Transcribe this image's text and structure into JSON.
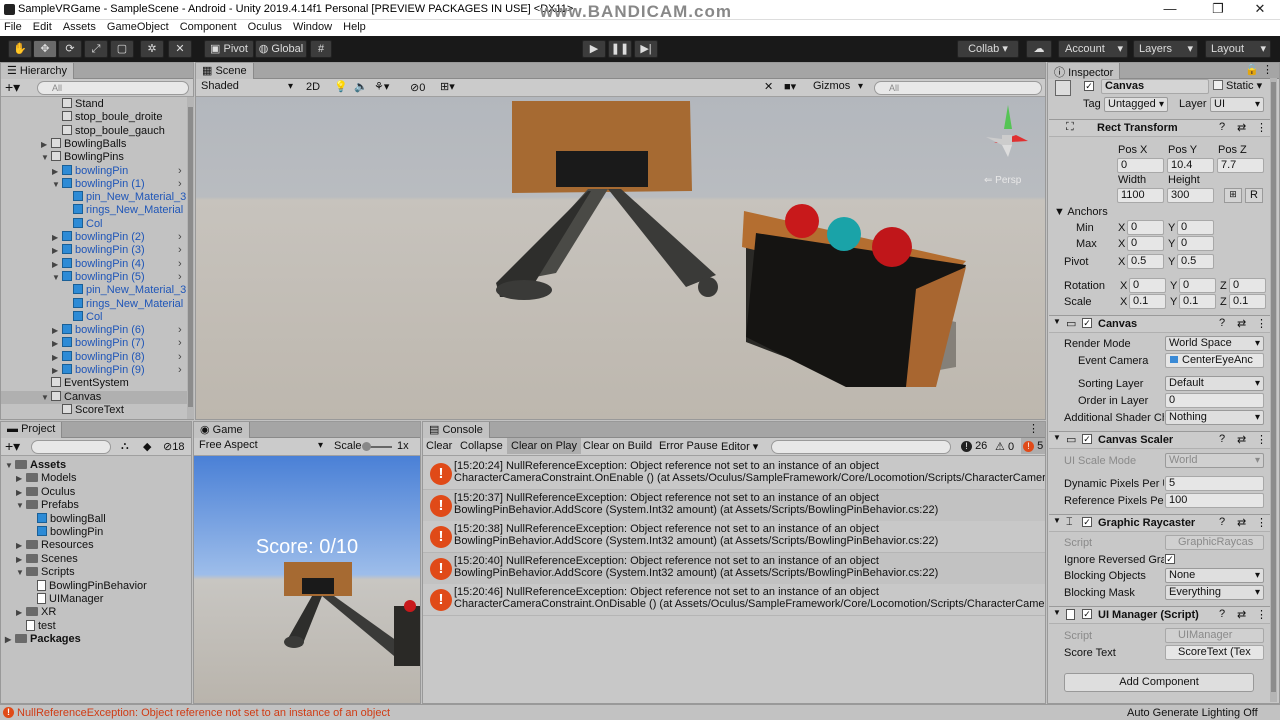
{
  "window": {
    "title": "SampleVRGame - SampleScene - Android - Unity 2019.4.14f1 Personal [PREVIEW PACKAGES IN USE] <DX11>",
    "watermark": "www.BANDICAM.com",
    "minimize": "—",
    "maximize": "❐",
    "close": "✕"
  },
  "menu": [
    "File",
    "Edit",
    "Assets",
    "GameObject",
    "Component",
    "Oculus",
    "Window",
    "Help"
  ],
  "toolbar": {
    "pivot": "Pivot",
    "global": "Global",
    "collab": "Collab ▾",
    "account": "Account",
    "layers": "Layers",
    "layout": "Layout"
  },
  "hierarchy": {
    "tab": "Hierarchy",
    "search_placeholder": "All",
    "items": [
      {
        "label": "Stand",
        "indent": 3,
        "prefab": false,
        "arrow": ""
      },
      {
        "label": "stop_boule_droite",
        "indent": 3,
        "prefab": false,
        "arrow": ""
      },
      {
        "label": "stop_boule_gauch",
        "indent": 3,
        "prefab": false,
        "arrow": ""
      },
      {
        "label": "BowlingBalls",
        "indent": 2,
        "prefab": false,
        "arrow": "▶"
      },
      {
        "label": "BowlingPins",
        "indent": 2,
        "prefab": false,
        "arrow": "▼"
      },
      {
        "label": "bowlingPin",
        "indent": 3,
        "prefab": true,
        "arrow": "▶"
      },
      {
        "label": "bowlingPin (1)",
        "indent": 3,
        "prefab": true,
        "arrow": "▼"
      },
      {
        "label": "pin_New_Material_3",
        "indent": 4,
        "prefab": true,
        "arrow": ""
      },
      {
        "label": "rings_New_Material",
        "indent": 4,
        "prefab": true,
        "arrow": ""
      },
      {
        "label": "Col",
        "indent": 4,
        "prefab": true,
        "arrow": ""
      },
      {
        "label": "bowlingPin (2)",
        "indent": 3,
        "prefab": true,
        "arrow": "▶"
      },
      {
        "label": "bowlingPin (3)",
        "indent": 3,
        "prefab": true,
        "arrow": "▶"
      },
      {
        "label": "bowlingPin (4)",
        "indent": 3,
        "prefab": true,
        "arrow": "▶"
      },
      {
        "label": "bowlingPin (5)",
        "indent": 3,
        "prefab": true,
        "arrow": "▼"
      },
      {
        "label": "pin_New_Material_3",
        "indent": 4,
        "prefab": true,
        "arrow": ""
      },
      {
        "label": "rings_New_Material",
        "indent": 4,
        "prefab": true,
        "arrow": ""
      },
      {
        "label": "Col",
        "indent": 4,
        "prefab": true,
        "arrow": ""
      },
      {
        "label": "bowlingPin (6)",
        "indent": 3,
        "prefab": true,
        "arrow": "▶"
      },
      {
        "label": "bowlingPin (7)",
        "indent": 3,
        "prefab": true,
        "arrow": "▶"
      },
      {
        "label": "bowlingPin (8)",
        "indent": 3,
        "prefab": true,
        "arrow": "▶"
      },
      {
        "label": "bowlingPin (9)",
        "indent": 3,
        "prefab": true,
        "arrow": "▶"
      },
      {
        "label": "EventSystem",
        "indent": 2,
        "prefab": false,
        "arrow": ""
      },
      {
        "label": "Canvas",
        "indent": 2,
        "prefab": false,
        "arrow": "▼"
      },
      {
        "label": "ScoreText",
        "indent": 3,
        "prefab": false,
        "arrow": ""
      }
    ]
  },
  "scene": {
    "tab": "Scene",
    "shading": "Shaded",
    "mode2d": "2D",
    "fx_count": "0",
    "gizmos": "Gizmos",
    "search_placeholder": "All",
    "persp": "Persp"
  },
  "project": {
    "tab": "Project",
    "count": "18",
    "tree": [
      {
        "label": "Assets",
        "indent": 0,
        "arrow": "▼",
        "type": "folder",
        "bold": true
      },
      {
        "label": "Models",
        "indent": 1,
        "arrow": "▶",
        "type": "folder",
        "bold": false
      },
      {
        "label": "Oculus",
        "indent": 1,
        "arrow": "▶",
        "type": "folder",
        "bold": false
      },
      {
        "label": "Prefabs",
        "indent": 1,
        "arrow": "▼",
        "type": "folder",
        "bold": false
      },
      {
        "label": "bowlingBall",
        "indent": 2,
        "arrow": "",
        "type": "prefab",
        "bold": false
      },
      {
        "label": "bowlingPin",
        "indent": 2,
        "arrow": "",
        "type": "prefab",
        "bold": false
      },
      {
        "label": "Resources",
        "indent": 1,
        "arrow": "▶",
        "type": "folder",
        "bold": false
      },
      {
        "label": "Scenes",
        "indent": 1,
        "arrow": "▶",
        "type": "folder",
        "bold": false
      },
      {
        "label": "Scripts",
        "indent": 1,
        "arrow": "▼",
        "type": "folder",
        "bold": false
      },
      {
        "label": "BowlingPinBehavior",
        "indent": 2,
        "arrow": "",
        "type": "script",
        "bold": false
      },
      {
        "label": "UIManager",
        "indent": 2,
        "arrow": "",
        "type": "script",
        "bold": false
      },
      {
        "label": "XR",
        "indent": 1,
        "arrow": "▶",
        "type": "folder",
        "bold": false
      },
      {
        "label": "test",
        "indent": 1,
        "arrow": "",
        "type": "script",
        "bold": false
      },
      {
        "label": "Packages",
        "indent": 0,
        "arrow": "▶",
        "type": "folder",
        "bold": true
      }
    ]
  },
  "game": {
    "tab": "Game",
    "aspect": "Free Aspect",
    "scale_label": "Scale",
    "scale_value": "1x",
    "score_text": "Score: 0/10"
  },
  "console": {
    "tab": "Console",
    "buttons": [
      "Clear",
      "Collapse",
      "Clear on Play",
      "Clear on Build",
      "Error Pause",
      "Editor ▾"
    ],
    "info_count": "26",
    "warn_count": "0",
    "error_count": "5",
    "entries": [
      {
        "line1": "[15:20:24] NullReferenceException: Object reference not set to an instance of an object",
        "line2": "CharacterCameraConstraint.OnEnable () (at Assets/Oculus/SampleFramework/Core/Locomotion/Scripts/CharacterCameraCo"
      },
      {
        "line1": "[15:20:37] NullReferenceException: Object reference not set to an instance of an object",
        "line2": "BowlingPinBehavior.AddScore (System.Int32 amount) (at Assets/Scripts/BowlingPinBehavior.cs:22)"
      },
      {
        "line1": "[15:20:38] NullReferenceException: Object reference not set to an instance of an object",
        "line2": "BowlingPinBehavior.AddScore (System.Int32 amount) (at Assets/Scripts/BowlingPinBehavior.cs:22)"
      },
      {
        "line1": "[15:20:40] NullReferenceException: Object reference not set to an instance of an object",
        "line2": "BowlingPinBehavior.AddScore (System.Int32 amount) (at Assets/Scripts/BowlingPinBehavior.cs:22)"
      },
      {
        "line1": "[15:20:46] NullReferenceException: Object reference not set to an instance of an object",
        "line2": "CharacterCameraConstraint.OnDisable () (at Assets/Oculus/SampleFramework/Core/Locomotion/Scripts/CharacterCamera"
      }
    ]
  },
  "inspector": {
    "tab": "Inspector",
    "object_name": "Canvas",
    "static_label": "Static ▾",
    "tag_label": "Tag",
    "tag_value": "Untagged",
    "layer_label": "Layer",
    "layer_value": "UI",
    "rect": {
      "title": "Rect Transform",
      "posx_label": "Pos X",
      "posy_label": "Pos Y",
      "posz_label": "Pos Z",
      "posx": "0",
      "posy": "10.4",
      "posz": "7.7",
      "width_label": "Width",
      "height_label": "Height",
      "width": "1100",
      "height": "300",
      "r_button": "R",
      "anchors_label": "Anchors",
      "min_label": "Min",
      "max_label": "Max",
      "min_x": "0",
      "min_y": "0",
      "max_x": "0",
      "max_y": "0",
      "pivot_label": "Pivot",
      "pivot_x": "0.5",
      "pivot_y": "0.5",
      "rotation_label": "Rotation",
      "rot_x": "0",
      "rot_y": "0",
      "rot_z": "0",
      "scale_label": "Scale",
      "scale_x": "0.1",
      "scale_y": "0.1",
      "scale_z": "0.1"
    },
    "canvas": {
      "title": "Canvas",
      "render_mode_label": "Render Mode",
      "render_mode": "World Space",
      "event_camera_label": "Event Camera",
      "event_camera": "CenterEyeAnc",
      "sorting_layer_label": "Sorting Layer",
      "sorting_layer": "Default",
      "order_label": "Order in Layer",
      "order": "0",
      "shader_label": "Additional Shader Ch",
      "shader": "Nothing"
    },
    "scaler": {
      "title": "Canvas Scaler",
      "ui_scale_label": "UI Scale Mode",
      "ui_scale": "World",
      "dpp_label": "Dynamic Pixels Per U",
      "dpp": "5",
      "rpp_label": "Reference Pixels Per",
      "rpp": "100"
    },
    "raycaster": {
      "title": "Graphic Raycaster",
      "script_label": "Script",
      "script": "GraphicRaycas",
      "ignore_label": "Ignore Reversed Gra",
      "blocking_objects_label": "Blocking Objects",
      "blocking_objects": "None",
      "blocking_mask_label": "Blocking Mask",
      "blocking_mask": "Everything"
    },
    "uimanager": {
      "title": "UI Manager (Script)",
      "script_label": "Script",
      "script": "UIManager",
      "score_label": "Score Text",
      "score": "ScoreText (Tex"
    },
    "add_component": "Add Component"
  },
  "statusbar": {
    "error": "NullReferenceException: Object reference not set to an instance of an object",
    "right": "Auto Generate Lighting Off"
  },
  "colors": {
    "error": "#e04a18",
    "prefab": "#1f56b8",
    "dark_toolbar": "#191919"
  }
}
